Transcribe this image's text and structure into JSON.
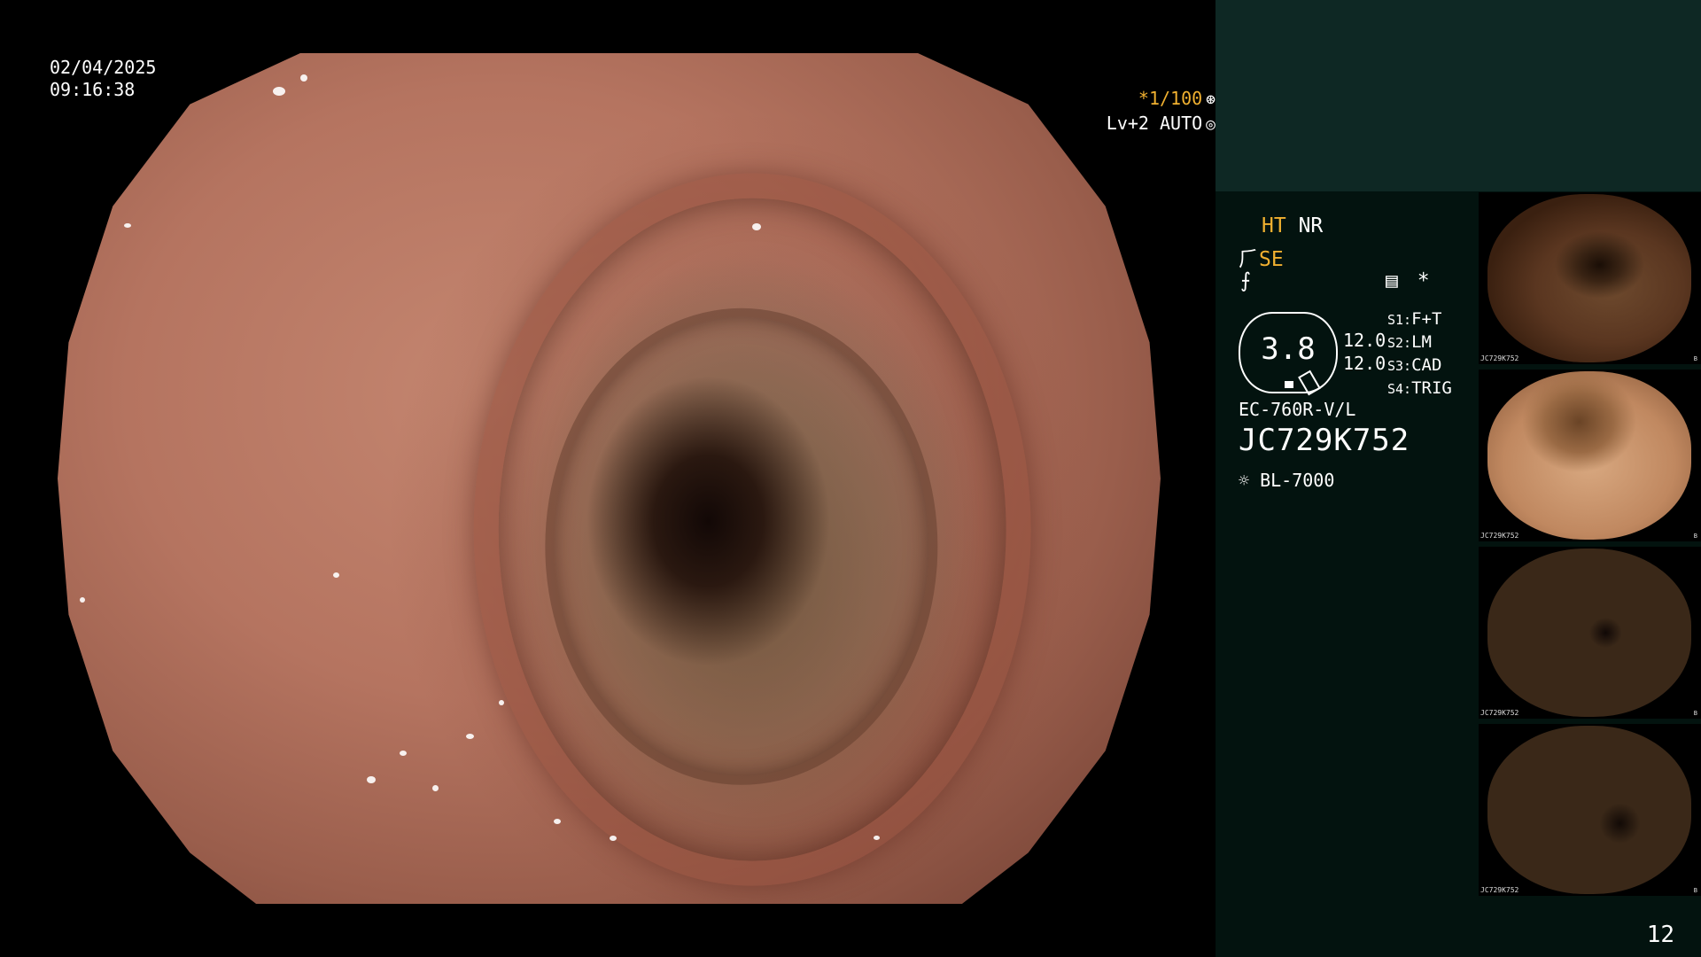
{
  "osd": {
    "date": "02/04/2025",
    "time": "09:16:38",
    "shutter": "*1/100",
    "shutter_icon": "⊛",
    "iris": "Lv+2 AUTO",
    "iris_icon": "◎"
  },
  "panel": {
    "ht": "HT",
    "nr": "NR",
    "se": "SE",
    "se_icon": "⺁",
    "f_icon": "⨍",
    "record_icon": "▤",
    "asterisk": "*",
    "magnification": "3.8",
    "value1": "12.0",
    "value2": "12.0",
    "settings": [
      {
        "key": "S1:",
        "value": "F+T"
      },
      {
        "key": "S2:",
        "value": "LM"
      },
      {
        "key": "S3:",
        "value": "CAD"
      },
      {
        "key": "S4:",
        "value": "TRIG"
      }
    ],
    "scope_model": "EC-760R-V/L",
    "serial": "JC729K752",
    "light_source": "BL-7000",
    "light_icon": "☼"
  },
  "thumbnails": [
    {
      "caption": "JC729K752",
      "icon": "B"
    },
    {
      "caption": "JC729K752",
      "icon": "B"
    },
    {
      "caption": "JC729K752",
      "icon": "B"
    },
    {
      "caption": "JC729K752",
      "icon": "B"
    }
  ],
  "page_number": "12",
  "colors": {
    "accent_yellow": "#f0b030",
    "panel_bg": "#03130f",
    "panel_top": "#0e2824"
  }
}
